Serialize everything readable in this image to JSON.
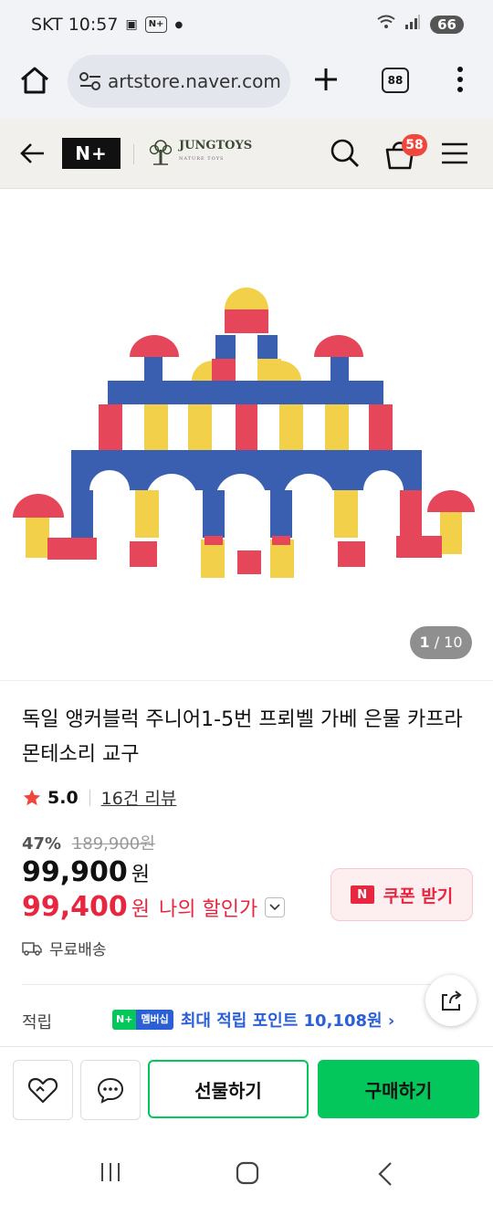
{
  "status_bar": {
    "carrier_time": "SKT 10:57",
    "battery": "66",
    "np_icon_text": "N+"
  },
  "browser": {
    "url": "artstore.naver.com",
    "tab_count": "88"
  },
  "site_header": {
    "np_logo": "N+",
    "brand_name": "JUNGTOYS",
    "brand_tagline": "NATURE TOYS",
    "cart_count": "58"
  },
  "gallery": {
    "current": "1",
    "separator": " / ",
    "total": "10"
  },
  "product": {
    "title": "독일 앵커블럭 주니어1-5번 프뢰벨 가베 은물 카프라 몬테소리 교구",
    "rating": "5.0",
    "reviews": "16건 리뷰",
    "discount_rate": "47%",
    "original_price": "189,900원",
    "price": "99,900",
    "price_unit": "원",
    "my_price": "99,400",
    "my_price_unit": "원",
    "my_price_label": "나의 할인가",
    "coupon_label": "쿠폰 받기",
    "coupon_icon_text": "N",
    "shipping": "무료배송",
    "points_label": "적립",
    "np_badge_np": "N+",
    "np_badge_membership": "멤버십",
    "points_text": "최대 적립 포인트 10,108원 ›"
  },
  "bottom_bar": {
    "gift_label": "선물하기",
    "buy_label": "구매하기"
  },
  "colors": {
    "brand_green": "#03c75a",
    "sale_red": "#e8263f",
    "point_blue": "#2b5fd6",
    "cart_badge": "#f0463c"
  }
}
